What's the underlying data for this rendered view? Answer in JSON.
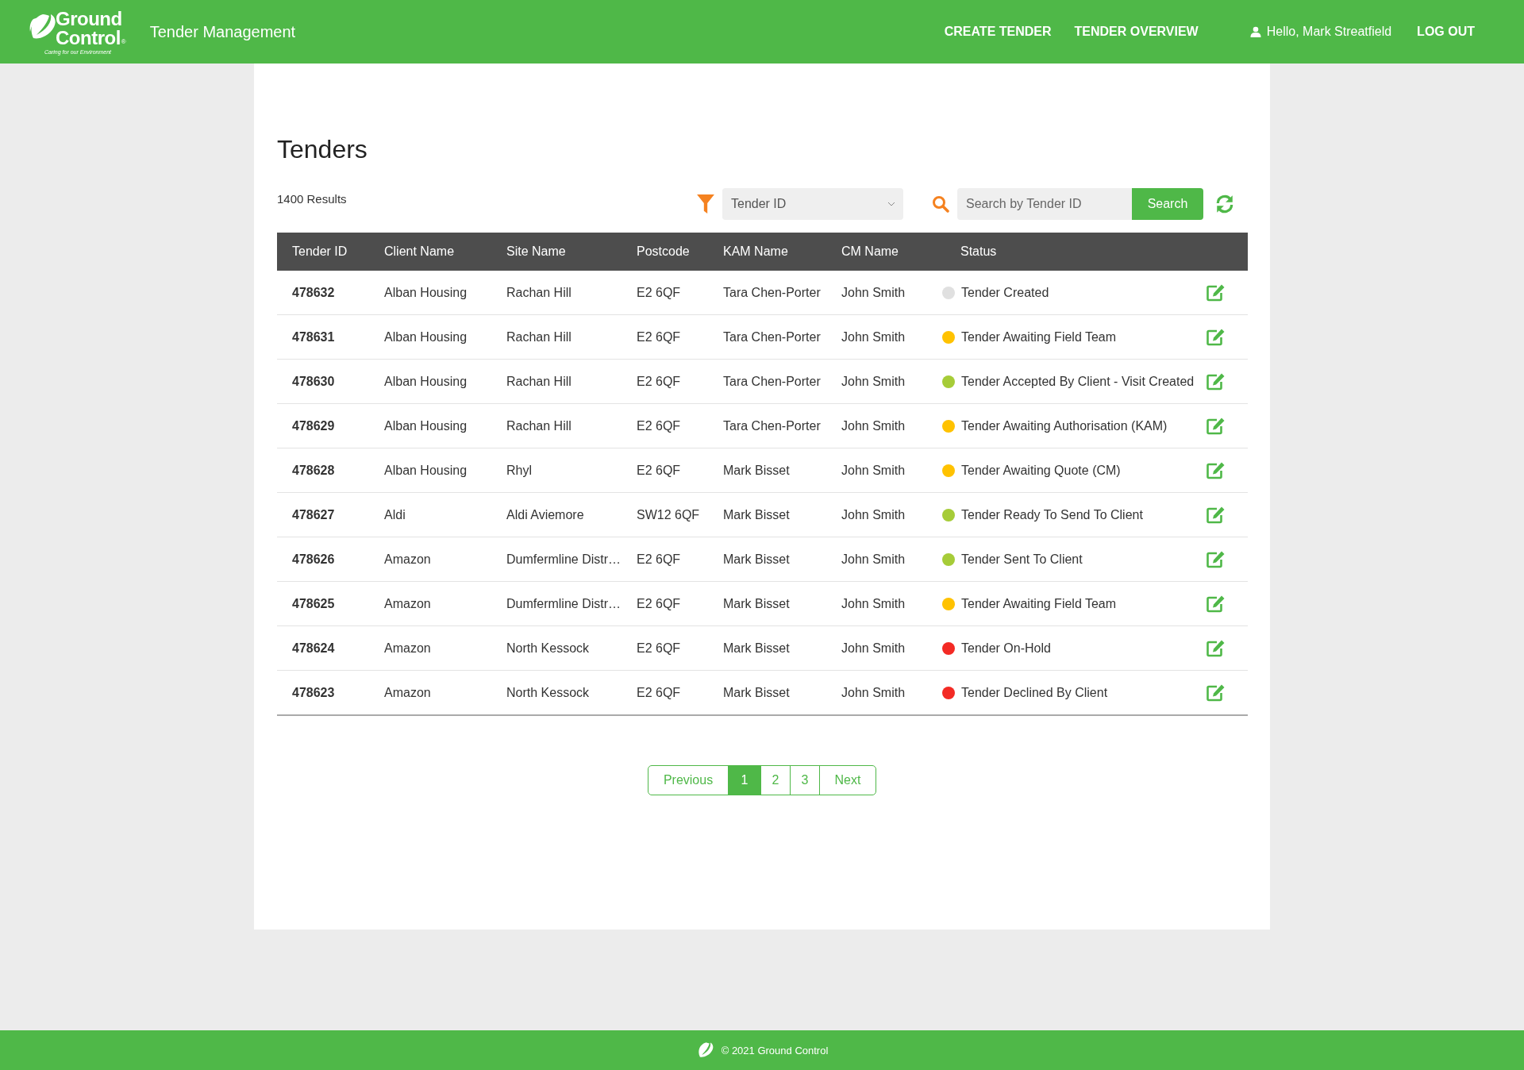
{
  "header": {
    "logo": {
      "line_1": "Ground",
      "line_2": "Control",
      "mark": "®",
      "tagline": "Caring for our Environment"
    },
    "app_title": "Tender Management",
    "nav": [
      "CREATE TENDER",
      "TENDER OVERVIEW"
    ],
    "greeting": "Hello, Mark Streatfield",
    "logout": "LOG OUT"
  },
  "page": {
    "title": "Tenders",
    "results": "1400 Results",
    "filter": {
      "value": "Tender ID"
    },
    "search": {
      "placeholder": "Search by Tender ID",
      "button": "Search"
    },
    "table": {
      "columns": [
        "Tender ID",
        "Client Name",
        "Site Name",
        "Postcode",
        "KAM Name",
        "CM Name",
        "Status"
      ],
      "rows": [
        {
          "tender_id": "478632",
          "client_name": "Alban Housing",
          "site_name": "Rachan Hill",
          "postcode": "E2 6QF",
          "kam_name": "Tara Chen-Porter",
          "cm_name": "John Smith",
          "status": "Tender Created",
          "color": "#e0e0e0"
        },
        {
          "tender_id": "478631",
          "client_name": "Alban Housing",
          "site_name": "Rachan Hill",
          "postcode": "E2 6QF",
          "kam_name": "Tara Chen-Porter",
          "cm_name": "John Smith",
          "status": "Tender Awaiting Field Team",
          "color": "#ffc200"
        },
        {
          "tender_id": "478630",
          "client_name": "Alban Housing",
          "site_name": "Rachan Hill",
          "postcode": "E2 6QF",
          "kam_name": "Tara Chen-Porter",
          "cm_name": "John Smith",
          "status": "Tender Accepted By Client - Visit Created",
          "color": "#a6cc38"
        },
        {
          "tender_id": "478629",
          "client_name": "Alban Housing",
          "site_name": "Rachan Hill",
          "postcode": "E2 6QF",
          "kam_name": "Tara Chen-Porter",
          "cm_name": "John Smith",
          "status": "Tender Awaiting Authorisation (KAM)",
          "color": "#ffc200"
        },
        {
          "tender_id": "478628",
          "client_name": "Alban Housing",
          "site_name": "Rhyl",
          "postcode": "E2 6QF",
          "kam_name": "Mark Bisset",
          "cm_name": "John Smith",
          "status": "Tender Awaiting Quote (CM)",
          "color": "#ffc200"
        },
        {
          "tender_id": "478627",
          "client_name": "Aldi",
          "site_name": "Aldi Aviemore",
          "postcode": "SW12 6QF",
          "kam_name": "Mark Bisset",
          "cm_name": "John Smith",
          "status": "Tender Ready To Send To Client",
          "color": "#a6cc38"
        },
        {
          "tender_id": "478626",
          "client_name": "Amazon",
          "site_name": "Dumfermline Distr…",
          "postcode": "E2 6QF",
          "kam_name": "Mark Bisset",
          "cm_name": "John Smith",
          "status": "Tender Sent To Client",
          "color": "#a6cc38"
        },
        {
          "tender_id": "478625",
          "client_name": "Amazon",
          "site_name": "Dumfermline Distr…",
          "postcode": "E2 6QF",
          "kam_name": "Mark Bisset",
          "cm_name": "John Smith",
          "status": "Tender Awaiting Field Team",
          "color": "#ffc200"
        },
        {
          "tender_id": "478624",
          "client_name": "Amazon",
          "site_name": "North Kessock",
          "postcode": "E2 6QF",
          "kam_name": "Mark Bisset",
          "cm_name": "John Smith",
          "status": "Tender On-Hold",
          "color": "#f32a24"
        },
        {
          "tender_id": "478623",
          "client_name": "Amazon",
          "site_name": "North Kessock",
          "postcode": "E2 6QF",
          "kam_name": "Mark Bisset",
          "cm_name": "John Smith",
          "status": "Tender Declined By Client",
          "color": "#f32a24"
        }
      ]
    },
    "pagination": {
      "previous": "Previous",
      "pages": [
        {
          "label": "1",
          "selected": true
        },
        {
          "label": "2",
          "selected": false
        },
        {
          "label": "3",
          "selected": false
        }
      ],
      "next": "Next"
    }
  },
  "footer": {
    "text": "© 2021 Ground Control"
  }
}
